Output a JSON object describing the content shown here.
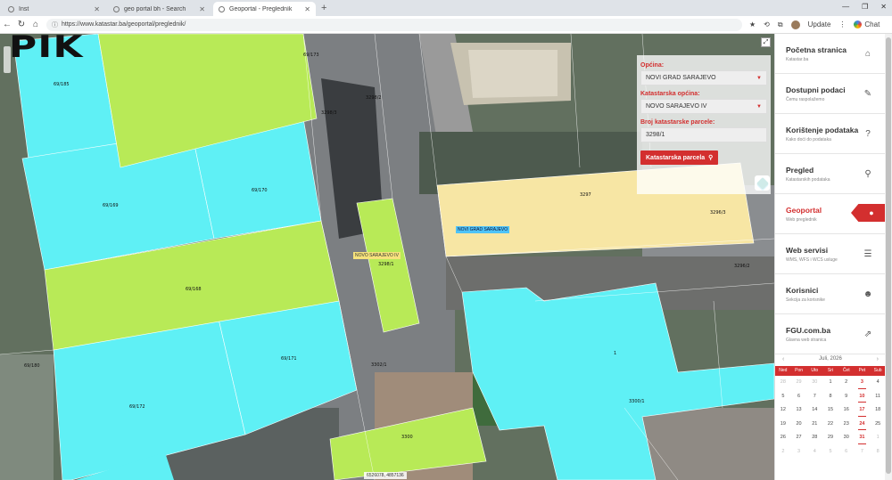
{
  "browser": {
    "tabs": [
      {
        "label": "Inst",
        "active": false
      },
      {
        "label": "geo portal bh - Search",
        "active": false
      },
      {
        "label": "Geoportal - Pregledník",
        "active": true
      }
    ],
    "url": "https://www.katastar.ba/geoportal/preglednik/",
    "update_label": "Update",
    "chat_label": "Chat"
  },
  "map": {
    "logo": "PIK",
    "parcel_labels": [
      {
        "text": "69/185"
      },
      {
        "text": "69/169"
      },
      {
        "text": "69/170"
      },
      {
        "text": "69/168"
      },
      {
        "text": "69/171"
      },
      {
        "text": "69/172"
      },
      {
        "text": "69/173"
      },
      {
        "text": "3298/1"
      },
      {
        "text": "3298/2"
      },
      {
        "text": "3298/3"
      },
      {
        "text": "3297"
      },
      {
        "text": "3296/3"
      },
      {
        "text": "3296/2"
      },
      {
        "text": "1"
      },
      {
        "text": "3300/1"
      },
      {
        "text": "3300"
      },
      {
        "text": "3302/1"
      },
      {
        "text": "69/180"
      }
    ],
    "tag_novo": "NOVO SARAJEVO IV",
    "tag_novi_grad": "NOVI GRAD SARAJEVO",
    "coordinates": "6526078, 4857136"
  },
  "search": {
    "opcina_label": "Općina:",
    "opcina_value": "NOVI GRAD SARAJEVO",
    "ko_label": "Katastarska općina:",
    "ko_value": "NOVO SARAJEVO IV",
    "parcel_label": "Broj katastarske parcele:",
    "parcel_value": "3298/1",
    "button_label": "Katastarska parcela"
  },
  "sidebar": {
    "items": [
      {
        "title": "Početna stranica",
        "sub": "Katastar.ba",
        "icon": "home-icon",
        "glyph": "⌂"
      },
      {
        "title": "Dostupni podaci",
        "sub": "Čemu raspolažemo",
        "icon": "paperclip-icon",
        "glyph": "✎"
      },
      {
        "title": "Korištenje podataka",
        "sub": "Kako doći do podataka",
        "icon": "question-icon",
        "glyph": "?"
      },
      {
        "title": "Pregled",
        "sub": "Katastarskih podataka",
        "icon": "search-icon",
        "glyph": "⚲"
      },
      {
        "title": "Geoportal",
        "sub": "Web preglednik",
        "icon": "map-marker-icon",
        "glyph": "⬤"
      },
      {
        "title": "Web servisi",
        "sub": "WMS, WFS i WCS usluge",
        "icon": "database-icon",
        "glyph": "☰"
      },
      {
        "title": "Korisnici",
        "sub": "Sekcija za korisnike",
        "icon": "users-icon",
        "glyph": "☻"
      },
      {
        "title": "FGU.com.ba",
        "sub": "Glavna web stranica",
        "icon": "external-link-icon",
        "glyph": "⇗"
      }
    ]
  },
  "calendar": {
    "month": "Juli, 2026",
    "days_of_week": [
      "Ned",
      "Pon",
      "Uto",
      "Sri",
      "Čet",
      "Pet",
      "Sub"
    ],
    "days": [
      {
        "d": "28",
        "m": true
      },
      {
        "d": "29",
        "m": true
      },
      {
        "d": "30",
        "m": true
      },
      {
        "d": "1"
      },
      {
        "d": "2"
      },
      {
        "d": "3",
        "k": true
      },
      {
        "d": "4"
      },
      {
        "d": "5"
      },
      {
        "d": "6"
      },
      {
        "d": "7"
      },
      {
        "d": "8"
      },
      {
        "d": "9"
      },
      {
        "d": "10",
        "k": true
      },
      {
        "d": "11"
      },
      {
        "d": "12"
      },
      {
        "d": "13"
      },
      {
        "d": "14"
      },
      {
        "d": "15"
      },
      {
        "d": "16"
      },
      {
        "d": "17",
        "k": true
      },
      {
        "d": "18"
      },
      {
        "d": "19"
      },
      {
        "d": "20"
      },
      {
        "d": "21"
      },
      {
        "d": "22"
      },
      {
        "d": "23"
      },
      {
        "d": "24",
        "k": true
      },
      {
        "d": "25"
      },
      {
        "d": "26"
      },
      {
        "d": "27"
      },
      {
        "d": "28"
      },
      {
        "d": "29"
      },
      {
        "d": "30"
      },
      {
        "d": "31",
        "k": true
      },
      {
        "d": "1",
        "m": true
      },
      {
        "d": "2",
        "m": true
      },
      {
        "d": "3",
        "m": true
      },
      {
        "d": "4",
        "m": true
      },
      {
        "d": "5",
        "m": true
      },
      {
        "d": "6",
        "m": true
      },
      {
        "d": "7",
        "m": true
      },
      {
        "d": "8",
        "m": true
      }
    ]
  }
}
